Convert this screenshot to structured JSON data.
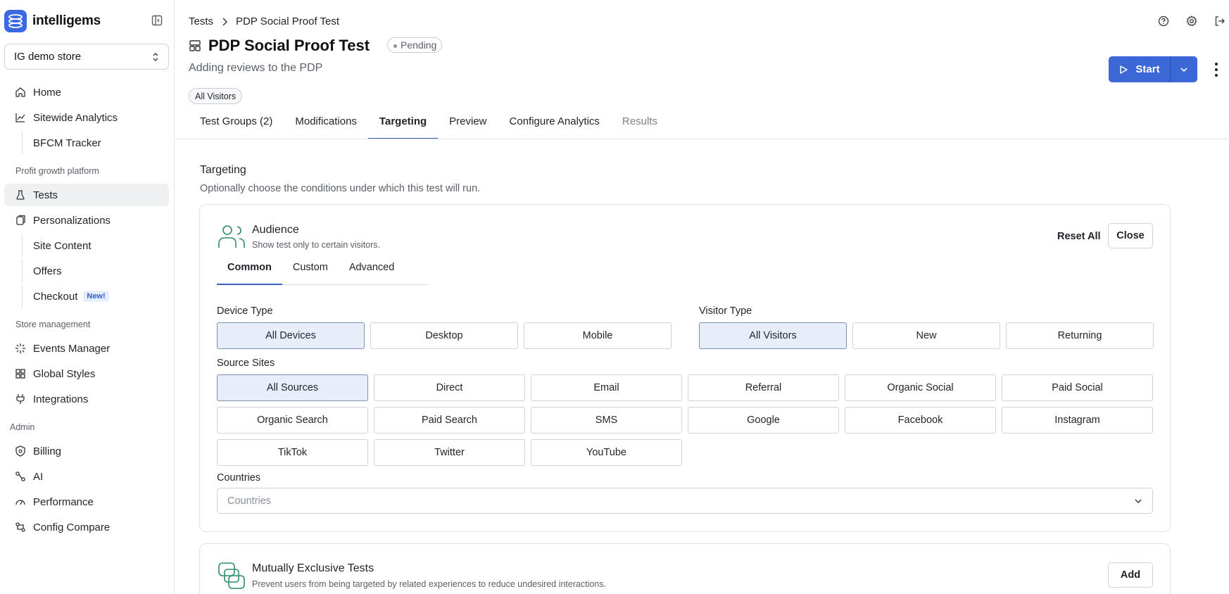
{
  "brand": {
    "name": "intelligems",
    "accent": "#3b68e3"
  },
  "store": {
    "selected": "IG demo store"
  },
  "sidebar": {
    "items": [
      {
        "label": "Home",
        "icon": "home-icon"
      },
      {
        "label": "Sitewide Analytics",
        "icon": "chart-icon"
      },
      {
        "label": "BFCM Tracker"
      },
      {
        "label": "Tests",
        "icon": "flask-icon"
      },
      {
        "label": "Personalizations",
        "icon": "personalization-icon"
      },
      {
        "label": "Site Content"
      },
      {
        "label": "Offers"
      },
      {
        "label": "Checkout",
        "badge": "New!"
      },
      {
        "label": "Events Manager",
        "icon": "sparkle-icon"
      },
      {
        "label": "Global Styles",
        "icon": "grid-icon"
      },
      {
        "label": "Integrations",
        "icon": "plug-icon"
      },
      {
        "label": "Billing",
        "icon": "shield-icon"
      },
      {
        "label": "AI",
        "icon": "ai-icon"
      },
      {
        "label": "Performance",
        "icon": "gauge-icon"
      },
      {
        "label": "Config Compare",
        "icon": "compare-icon"
      }
    ],
    "sections": {
      "profit": "Profit growth platform",
      "store": "Store management",
      "admin": "Admin"
    }
  },
  "breadcrumb": {
    "root": "Tests",
    "current": "PDP Social Proof Test"
  },
  "page": {
    "title": "PDP Social Proof Test",
    "status": "Pending",
    "subtitle": "Adding reviews to the PDP",
    "audience_chip": "All Visitors",
    "start_label": "Start"
  },
  "tabs": [
    {
      "label": "Test Groups (2)"
    },
    {
      "label": "Modifications"
    },
    {
      "label": "Targeting",
      "active": true
    },
    {
      "label": "Preview"
    },
    {
      "label": "Configure Analytics"
    },
    {
      "label": "Results",
      "disabled": true
    }
  ],
  "targeting": {
    "title": "Targeting",
    "description": "Optionally choose the conditions under which this test will run.",
    "audience": {
      "title": "Audience",
      "description": "Show test only to certain visitors.",
      "reset_label": "Reset All",
      "close_label": "Close",
      "sub_tabs": [
        "Common",
        "Custom",
        "Advanced"
      ],
      "device_type": {
        "label": "Device Type",
        "options": [
          "All Devices",
          "Desktop",
          "Mobile"
        ],
        "selected": "All Devices"
      },
      "visitor_type": {
        "label": "Visitor Type",
        "options": [
          "All Visitors",
          "New",
          "Returning"
        ],
        "selected": "All Visitors"
      },
      "source_sites": {
        "label": "Source Sites",
        "options": [
          "All Sources",
          "Direct",
          "Email",
          "Referral",
          "Organic Social",
          "Paid Social",
          "Organic Search",
          "Paid Search",
          "SMS",
          "Google",
          "Facebook",
          "Instagram",
          "TikTok",
          "Twitter",
          "YouTube"
        ],
        "selected": "All Sources"
      },
      "countries": {
        "label": "Countries",
        "placeholder": "Countries"
      }
    },
    "mutually_exclusive": {
      "title": "Mutually Exclusive Tests",
      "description": "Prevent users from being targeted by related experiences to reduce undesired interactions.",
      "add_label": "Add"
    }
  }
}
